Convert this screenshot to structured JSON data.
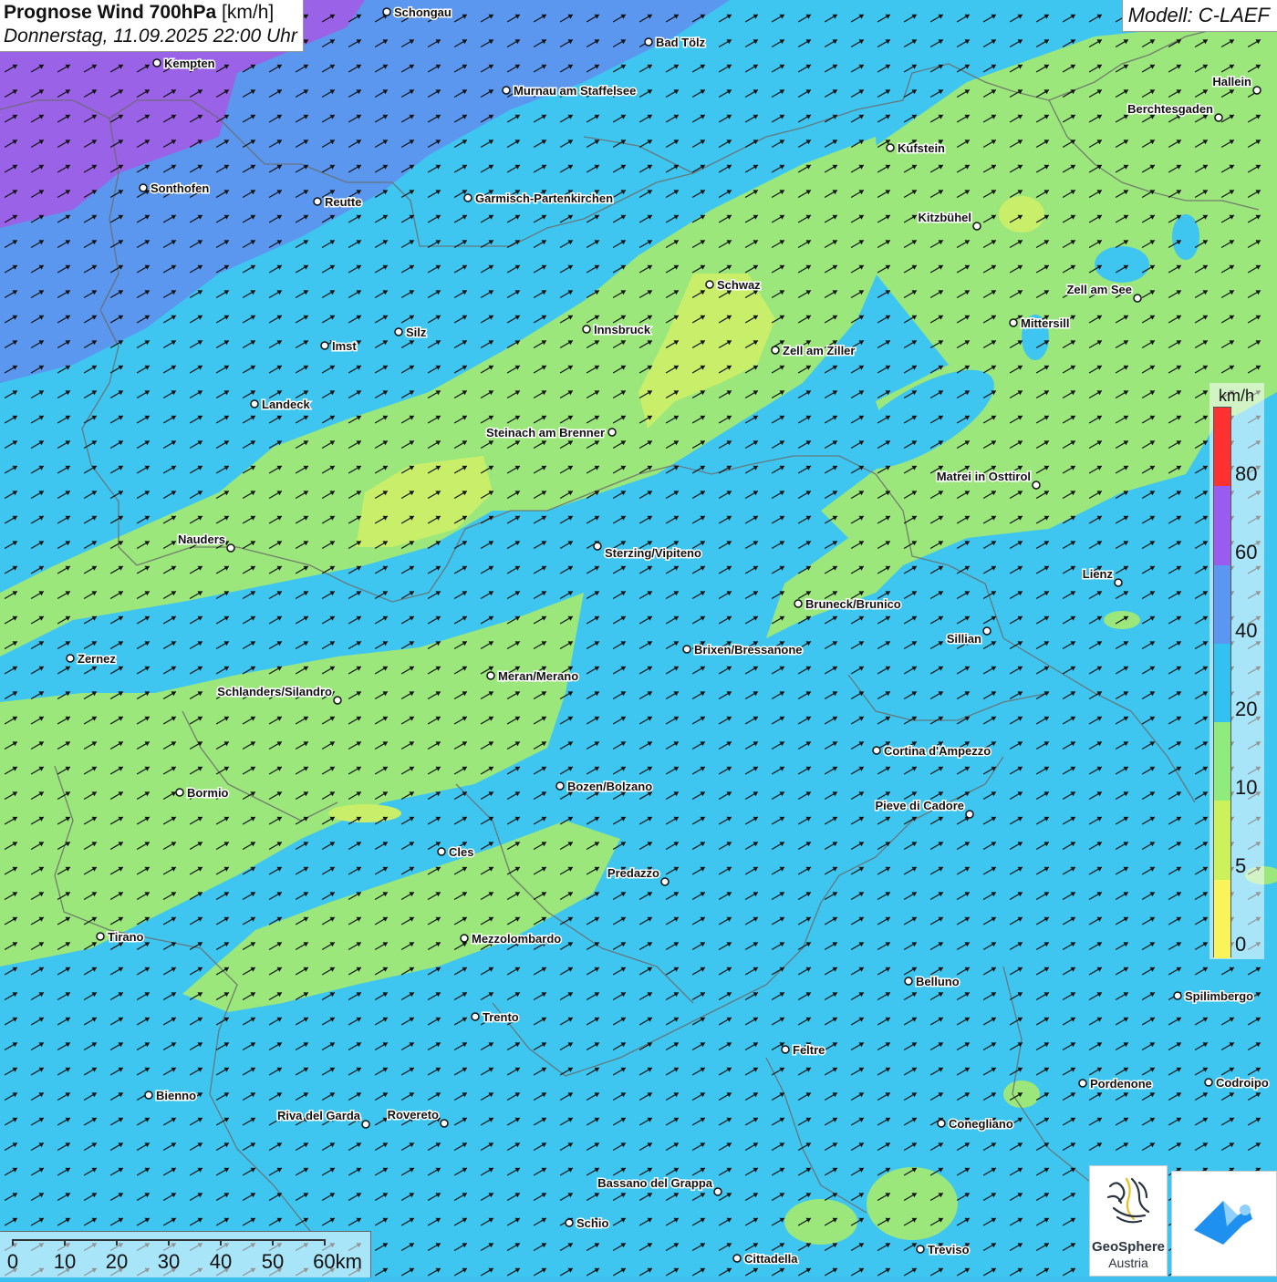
{
  "title": {
    "main": "Prognose Wind 700hPa",
    "unit": "[km/h]",
    "datetime": "Donnerstag, 11.09.2025 22:00 Uhr"
  },
  "model": "Modell: C-LAEF",
  "legend": {
    "unit": "km/h",
    "labels": [
      "80",
      "60",
      "40",
      "20",
      "10",
      "5",
      "0"
    ],
    "colors": [
      "#ff3030",
      "#9a5cf0",
      "#5a96f2",
      "#32c2f2",
      "#8fec7c",
      "#cbf25a",
      "#f8f45a"
    ]
  },
  "scale_bar": {
    "labels": [
      "0",
      "10",
      "20",
      "30",
      "40",
      "50",
      "60km"
    ]
  },
  "colors": {
    "band_0_5": "#f2f25e",
    "band_5_10": "#c9ef6a",
    "band_10_20": "#9be77c",
    "band_20_40": "#3ec6f0",
    "band_40_60": "#5b97ee",
    "band_60_80": "#9a62e6",
    "border": "#6b6b6b",
    "arrow": "#111111"
  },
  "wind": {
    "direction_towards_deg": 60,
    "description": "predominantly south-westerly flow"
  },
  "cities": [
    {
      "name": "Schongau"
    },
    {
      "name": "Bad Tölz"
    },
    {
      "name": "Kempten"
    },
    {
      "name": "Murnau am Staffelsee"
    },
    {
      "name": "Hallein"
    },
    {
      "name": "Berchtesgaden"
    },
    {
      "name": "Kufstein"
    },
    {
      "name": "Sonthofen"
    },
    {
      "name": "Reutte"
    },
    {
      "name": "Garmisch-Partenkirchen"
    },
    {
      "name": "Kitzbühel"
    },
    {
      "name": "Schwaz"
    },
    {
      "name": "Zell am See"
    },
    {
      "name": "Mittersill"
    },
    {
      "name": "Innsbruck"
    },
    {
      "name": "Imst"
    },
    {
      "name": "Silz"
    },
    {
      "name": "Zell am Ziller"
    },
    {
      "name": "Landeck"
    },
    {
      "name": "Steinach am Brenner"
    },
    {
      "name": "Matrei in Osttirol"
    },
    {
      "name": "Nauders"
    },
    {
      "name": "Sterzing/Vipiteno"
    },
    {
      "name": "Lienz"
    },
    {
      "name": "Bruneck/Brunico"
    },
    {
      "name": "Sillian"
    },
    {
      "name": "Brixen/Bressanone"
    },
    {
      "name": "Zernez"
    },
    {
      "name": "Meran/Merano"
    },
    {
      "name": "Schlanders/Silandro"
    },
    {
      "name": "Cortina d'Ampezzo"
    },
    {
      "name": "Bozen/Bolzano"
    },
    {
      "name": "Bormio"
    },
    {
      "name": "Pieve di Cadore"
    },
    {
      "name": "Cles"
    },
    {
      "name": "Predazzo"
    },
    {
      "name": "Tirano"
    },
    {
      "name": "Mezzolombardo"
    },
    {
      "name": "Belluno"
    },
    {
      "name": "Spilimbergo"
    },
    {
      "name": "Trento"
    },
    {
      "name": "Feltre"
    },
    {
      "name": "Bienno"
    },
    {
      "name": "Pordenone"
    },
    {
      "name": "Codroipo"
    },
    {
      "name": "Riva del Garda"
    },
    {
      "name": "Rovereto"
    },
    {
      "name": "Conegliano"
    },
    {
      "name": "Bassano del Grappa"
    },
    {
      "name": "Schio"
    },
    {
      "name": "Treviso"
    },
    {
      "name": "Cittadella"
    }
  ],
  "logos": {
    "geosphere_name": "GeoSphere",
    "geosphere_sub": "Austria"
  }
}
